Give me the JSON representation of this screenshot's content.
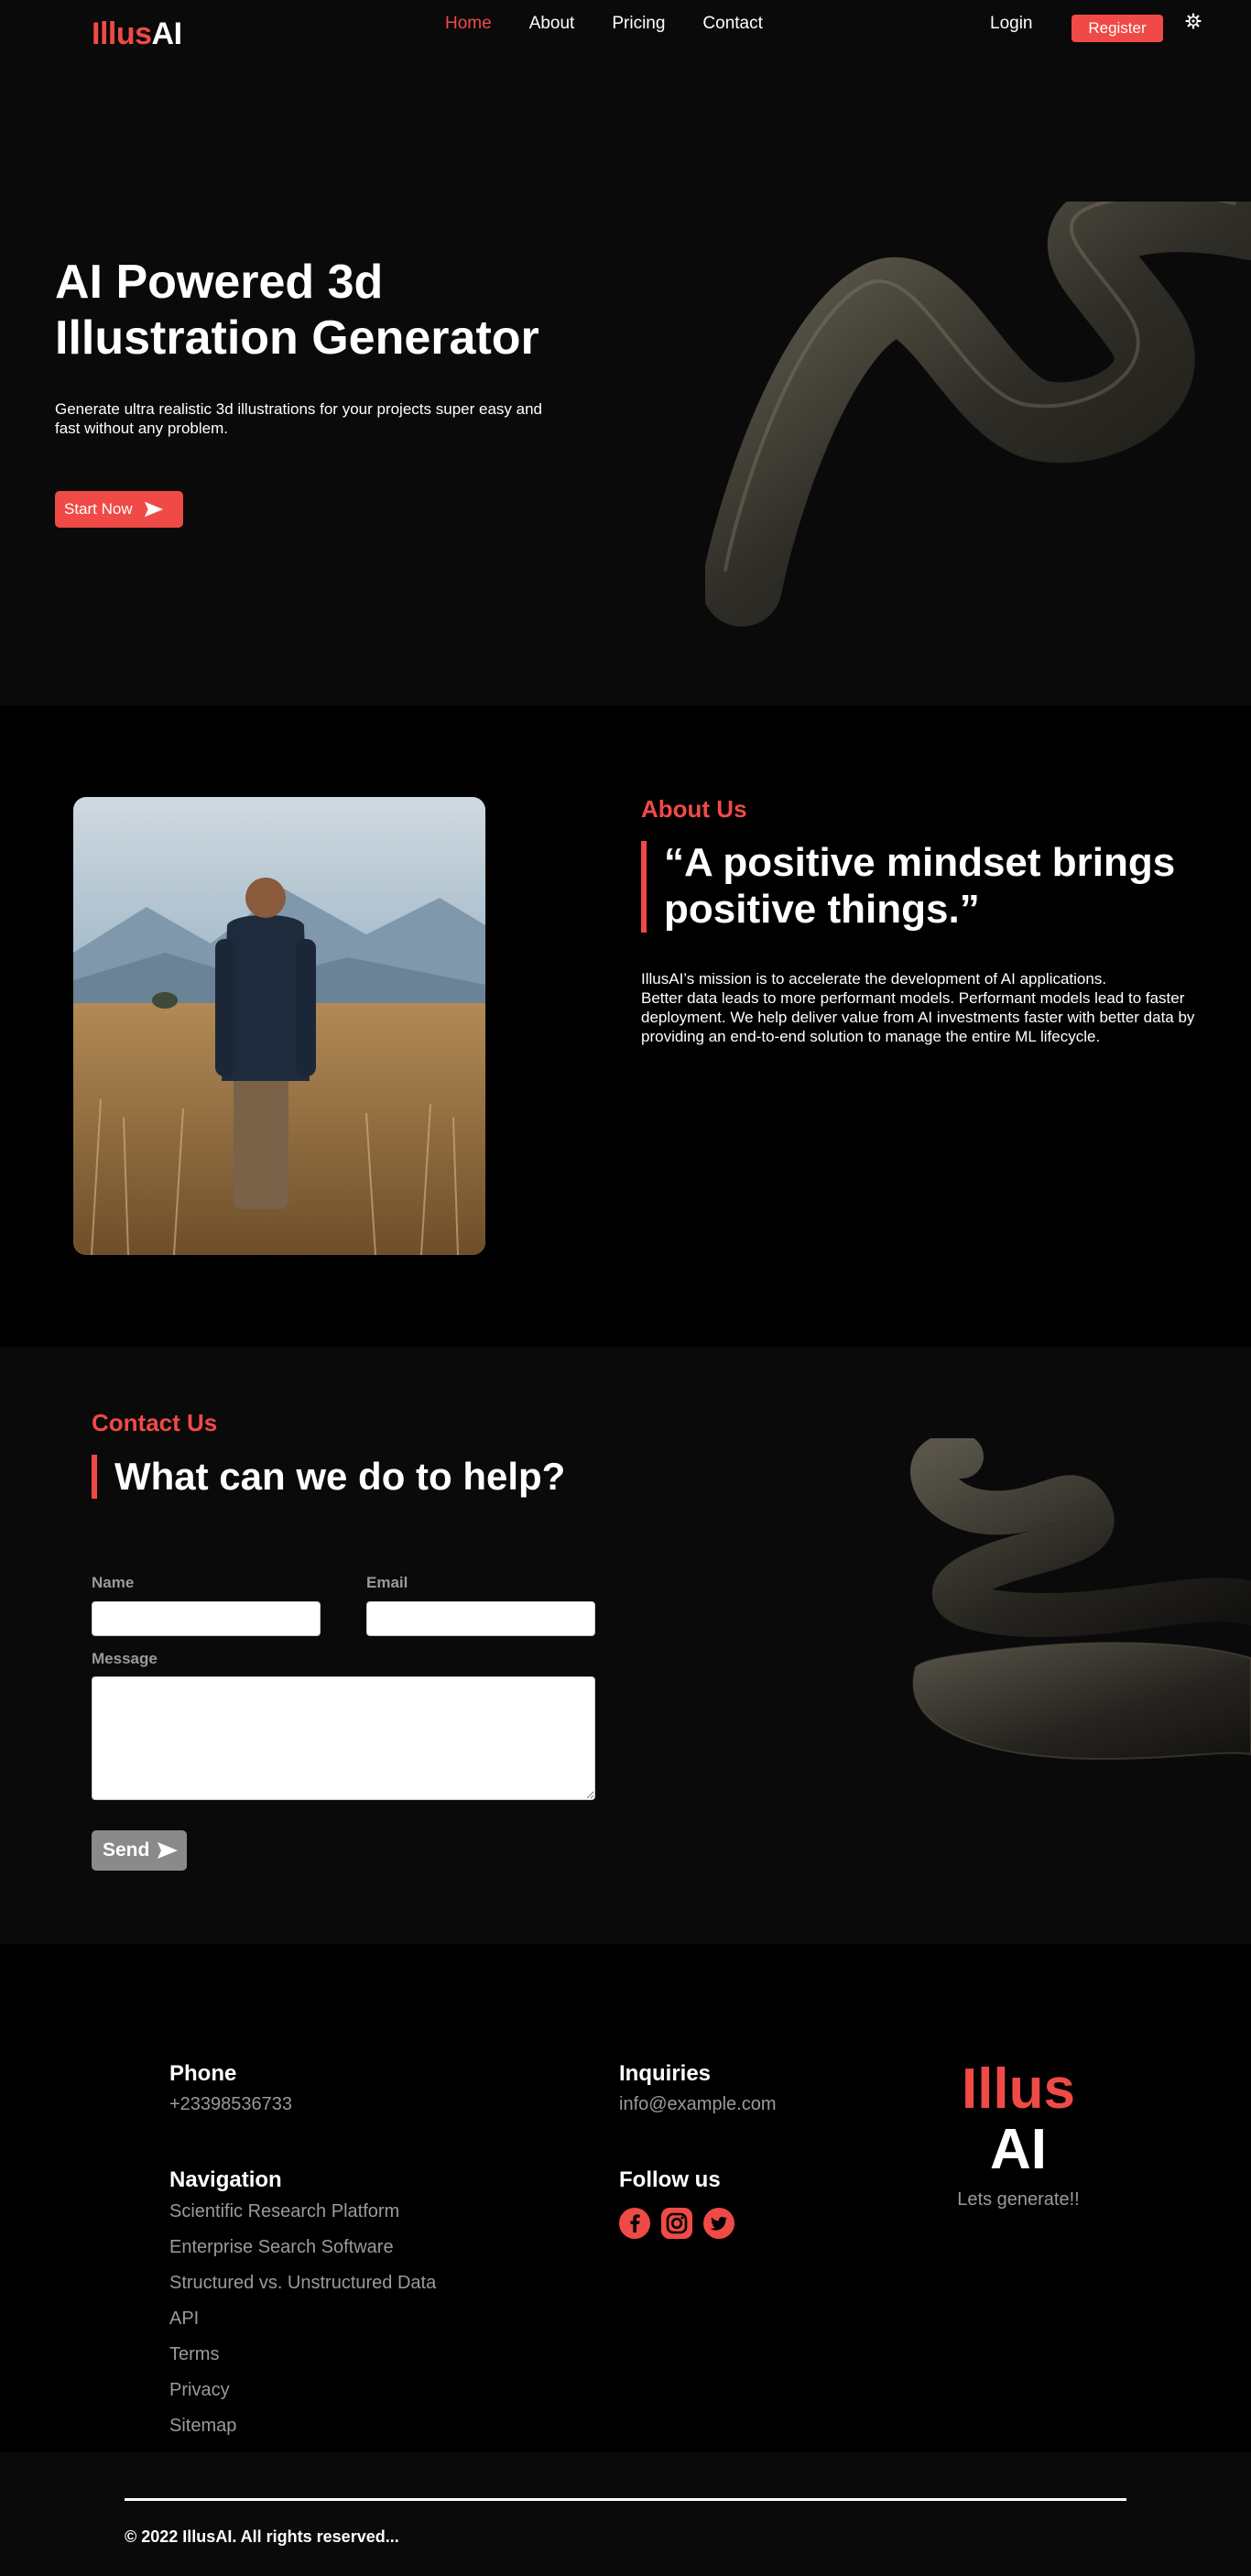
{
  "brand": {
    "part1": "Illus",
    "part2": "AI",
    "accent": "#f04a46"
  },
  "nav": {
    "links": [
      {
        "label": "Home",
        "active": true
      },
      {
        "label": "About"
      },
      {
        "label": "Pricing"
      },
      {
        "label": "Contact"
      }
    ],
    "login_label": "Login",
    "register_label": "Register",
    "settings_icon": "gear-icon"
  },
  "hero": {
    "title": "AI Powered 3d Illustration Generator",
    "subtitle": "Generate ultra realistic 3d illustrations for your projects super easy and fast without any problem.",
    "cta_label": "Start Now",
    "cta_icon": "send-arrow-icon"
  },
  "about": {
    "kicker": "About Us",
    "quote": "“A positive mindset brings positive things.”",
    "paragraphs": [
      "IllusAI’s mission is to accelerate the development of AI applications.",
      "Better data leads to more performant models. Performant models lead to faster deployment. We help deliver value from AI investments faster with better data by providing an end-to-end solution to manage the entire ML lifecycle."
    ]
  },
  "contact": {
    "kicker": "Contact Us",
    "title": "What can we do to help?",
    "name_label": "Name",
    "email_label": "Email",
    "message_label": "Message",
    "name_value": "",
    "email_value": "",
    "message_value": "",
    "send_label": "Send"
  },
  "footer": {
    "phone_heading": "Phone",
    "phone": "+23398536733",
    "inquiries_heading": "Inquiries",
    "email": "info@example.com",
    "navigation_heading": "Navigation",
    "nav_links": [
      "Scientific Research Platform",
      "Enterprise Search Software",
      "Structured vs. Unstructured Data",
      "API",
      "Terms",
      "Privacy",
      "Sitemap"
    ],
    "follow_heading": "Follow us",
    "socials": [
      "facebook-icon",
      "instagram-icon",
      "twitter-icon"
    ],
    "logo_part1": "Illus",
    "logo_part2": "AI",
    "tagline": "Lets generate!!",
    "copyright": "© 2022 IllusAI. All rights reserved..."
  }
}
